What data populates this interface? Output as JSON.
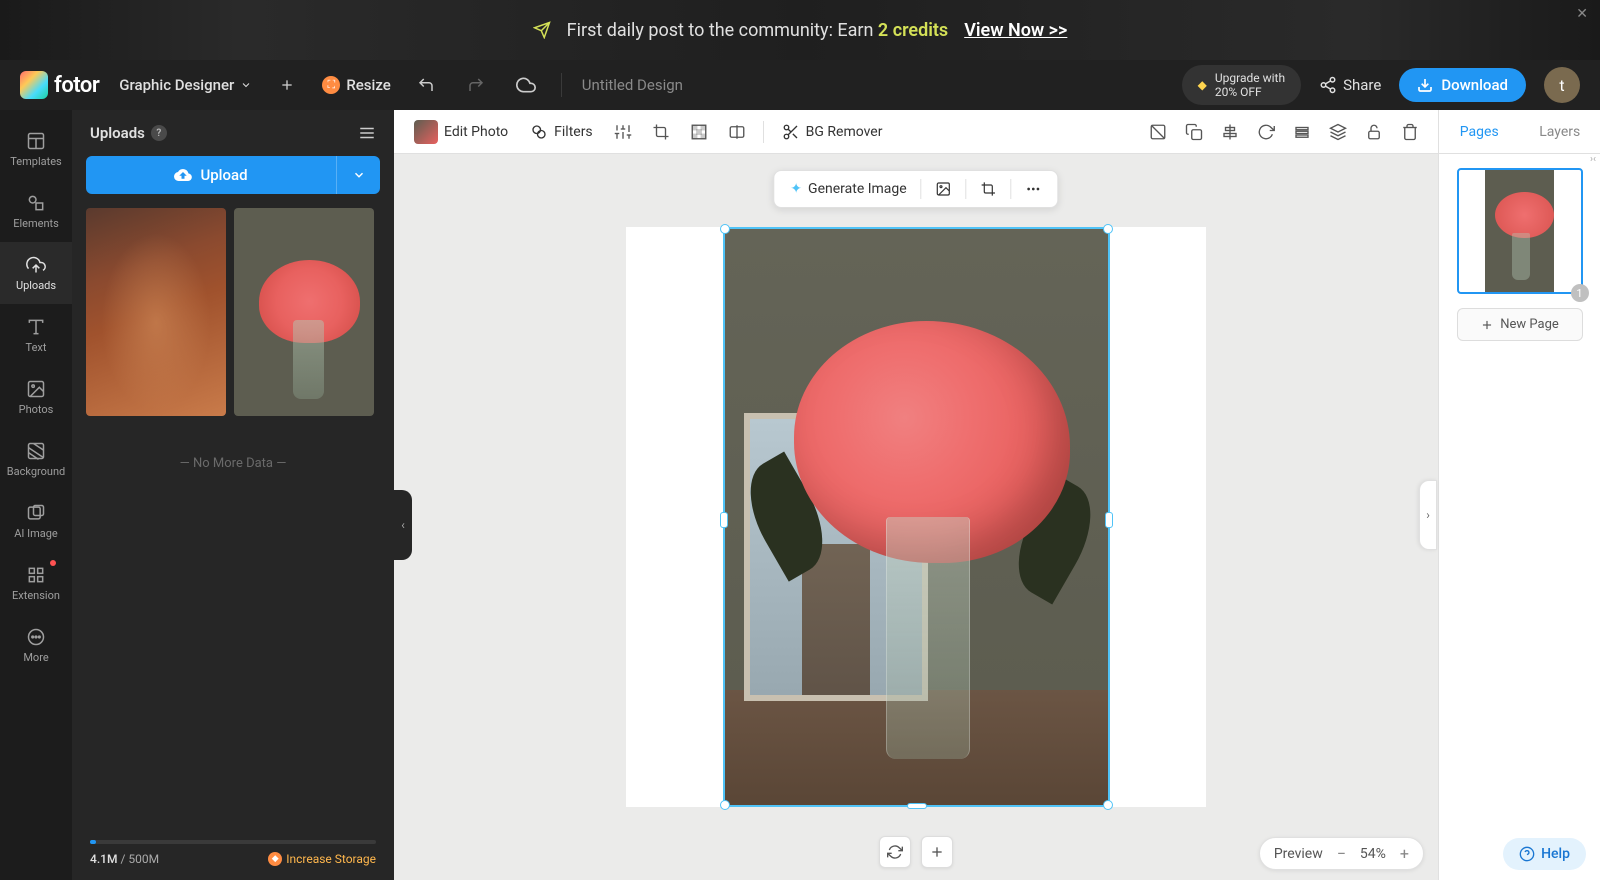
{
  "banner": {
    "text_prefix": "First daily post to the community: Earn ",
    "credits_count": "2",
    "credits_word": " credits",
    "cta": "View Now >>"
  },
  "header": {
    "brand": "fotor",
    "mode": "Graphic Designer",
    "resize": "Resize",
    "doc_title": "Untitled Design",
    "upgrade_line1": "Upgrade with",
    "upgrade_line2": "20% OFF",
    "share": "Share",
    "download": "Download",
    "avatar_letter": "t"
  },
  "nav": {
    "items": [
      {
        "label": "Templates"
      },
      {
        "label": "Elements"
      },
      {
        "label": "Uploads"
      },
      {
        "label": "Text"
      },
      {
        "label": "Photos"
      },
      {
        "label": "Background"
      },
      {
        "label": "AI Image"
      },
      {
        "label": "Extension"
      },
      {
        "label": "More"
      }
    ]
  },
  "panel": {
    "title": "Uploads",
    "upload": "Upload",
    "no_more": "— No More Data —",
    "storage_used": "4.1M",
    "storage_sep": " / ",
    "storage_total": "500M",
    "increase": "Increase Storage"
  },
  "context": {
    "edit_photo": "Edit Photo",
    "filters": "Filters",
    "bg_remover": "BG Remover"
  },
  "floating": {
    "generate": "Generate Image"
  },
  "zoom": {
    "preview": "Preview",
    "level": "54%"
  },
  "pages": {
    "tab_pages": "Pages",
    "tab_layers": "Layers",
    "page_number": "1",
    "new_page": "New Page"
  },
  "help": {
    "label": "Help"
  }
}
